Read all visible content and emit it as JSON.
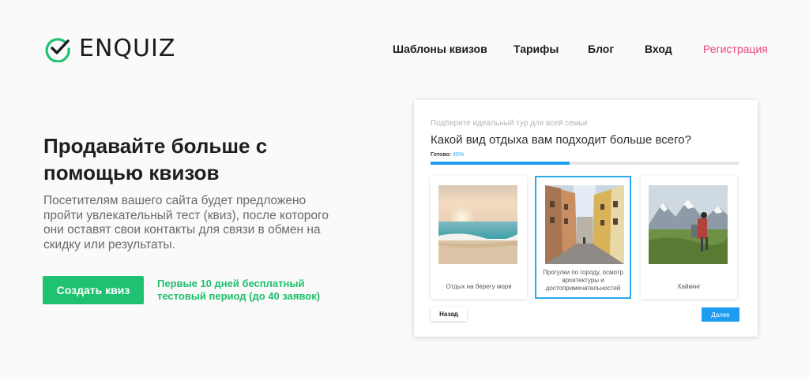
{
  "brand": {
    "name": "ENQUIZ",
    "accent": "#1fc271",
    "logo_icon": "check-circle-icon"
  },
  "nav": {
    "items": [
      "Шаблоны квизов",
      "Тарифы",
      "Блог",
      "Вход"
    ],
    "register": "Регистрация",
    "register_color": "#e8467c"
  },
  "hero": {
    "title": "Продавайте больше с помощью квизов",
    "description": "Посетителям вашего сайта будет предложено пройти увлекательный тест (квиз), после которого они оставят свои контакты для связи в обмен на скидку или результаты.",
    "cta": "Создать квиз",
    "trial": "Первые 10 дней бесплатный тестовый период (до 40 заявок)"
  },
  "quiz": {
    "subtitle": "Подберите идеальный тур для всей семьи",
    "question": "Какой вид отдыха вам подходит больше всего?",
    "progress_label": "Готово:",
    "progress_value": "45%",
    "progress_fraction": 0.45,
    "options": [
      {
        "label": "Отдых на берегу моря",
        "image": "beach-image",
        "selected": false
      },
      {
        "label": "Прогулки по городу, осмотр архитектуры и достопримечательностей",
        "image": "old-town-street-image",
        "selected": true
      },
      {
        "label": "Хайкинг",
        "image": "mountain-hiker-image",
        "selected": false
      }
    ],
    "back": "Назад",
    "next": "Далее",
    "next_color": "#1e9cf0"
  }
}
